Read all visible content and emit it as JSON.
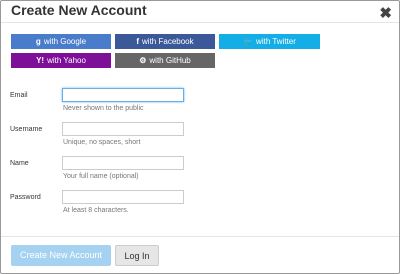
{
  "dialog": {
    "title": "Create New Account",
    "close_glyph": "✖"
  },
  "social": {
    "google": {
      "icon": "g",
      "label": "with Google"
    },
    "facebook": {
      "icon": "f",
      "label": "with Facebook"
    },
    "twitter": {
      "icon": "🐦",
      "label": "with Twitter"
    },
    "yahoo": {
      "icon": "Y!",
      "label": "with Yahoo"
    },
    "github": {
      "icon": "⚙",
      "label": "with GitHub"
    }
  },
  "form": {
    "email": {
      "label": "Email",
      "value": "",
      "help": "Never shown to the public"
    },
    "username": {
      "label": "Username",
      "value": "",
      "help": "Unique, no spaces, short"
    },
    "name": {
      "label": "Name",
      "value": "",
      "help": "Your full name (optional)"
    },
    "password": {
      "label": "Password",
      "value": "",
      "help": "At least 8 characters."
    }
  },
  "actions": {
    "create_label": "Create New Account",
    "login_label": "Log In"
  },
  "colors": {
    "google": "#4a7ccc",
    "facebook": "#3b5998",
    "twitter": "#14aee6",
    "yahoo": "#7d0f98",
    "github": "#666666",
    "create_button": "#a6d2f1",
    "focus_border": "#66afe9"
  }
}
